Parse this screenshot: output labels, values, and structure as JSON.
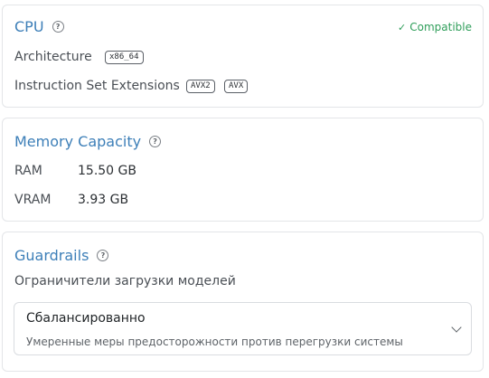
{
  "cpu": {
    "title": "CPU",
    "help_icon": "?",
    "status": {
      "check_icon": "✓",
      "label": "Compatible",
      "color": "#2f9e5a"
    },
    "architecture_label": "Architecture",
    "architecture_value": "x86_64",
    "extensions_label": "Instruction Set Extensions",
    "extensions": [
      "AVX2",
      "AVX"
    ]
  },
  "memory": {
    "title": "Memory Capacity",
    "help_icon": "?",
    "ram_label": "RAM",
    "ram_value": "15.50 GB",
    "vram_label": "VRAM",
    "vram_value": "3.93 GB"
  },
  "guardrails": {
    "title": "Guardrails",
    "help_icon": "?",
    "subtitle": "Ограничители загрузки моделей",
    "select": {
      "value": "Сбалансированно",
      "description": "Умеренные меры предосторожности против перегрузки системы"
    }
  },
  "colors": {
    "accent": "#3d7fb8",
    "border": "#e3e5e8"
  }
}
